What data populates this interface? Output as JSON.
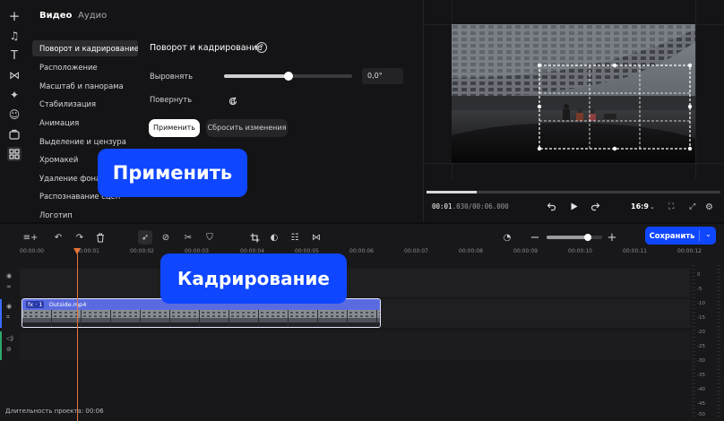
{
  "tabs": {
    "video": "Видео",
    "audio": "Аудио"
  },
  "nav": [
    "Поворот и кадрирование",
    "Расположение",
    "Масштаб и панорама",
    "Стабилизация",
    "Анимация",
    "Выделение и цензура",
    "Хромакей",
    "Удаление фона",
    "Распознавание сцен",
    "Логотип"
  ],
  "panel": {
    "title": "Поворот и кадрирование",
    "help_glyph": "?",
    "align_label": "Выровнять",
    "align_value": "0,0°",
    "slider_level": 0.5,
    "rotate_label": "Повернуть",
    "apply_label": "Применить",
    "reset_label": "Сбросить изменения"
  },
  "callouts": {
    "apply": "Применить",
    "crop": "Кадрирование"
  },
  "preview": {
    "time_current": "00:01",
    "time_current_ms": ".030",
    "time_total": "/00:06.000",
    "aspect": "16:9",
    "progress": 0.17
  },
  "toolbar": {
    "save_label": "Сохранить"
  },
  "ruler": [
    "00:00:00",
    "00:00:01",
    "00:00:02",
    "00:00:03",
    "00:00:04",
    "00:00:05",
    "00:00:06",
    "00:00:07",
    "00:00:08",
    "00:00:09",
    "00:00:10",
    "00:00:11",
    "00:00:12"
  ],
  "clip": {
    "fx": "fx · 1",
    "name": "Outside.mp4"
  },
  "meter_labels": [
    "0",
    "-5",
    "-10",
    "-15",
    "-20",
    "-25",
    "-30",
    "-35",
    "-40",
    "-45",
    "-50"
  ],
  "status": {
    "duration": "Длительность проекта: 00:06"
  },
  "colors": {
    "accent": "#0f46ff",
    "playhead": "#e8743b",
    "clip": "#5a6be0"
  }
}
